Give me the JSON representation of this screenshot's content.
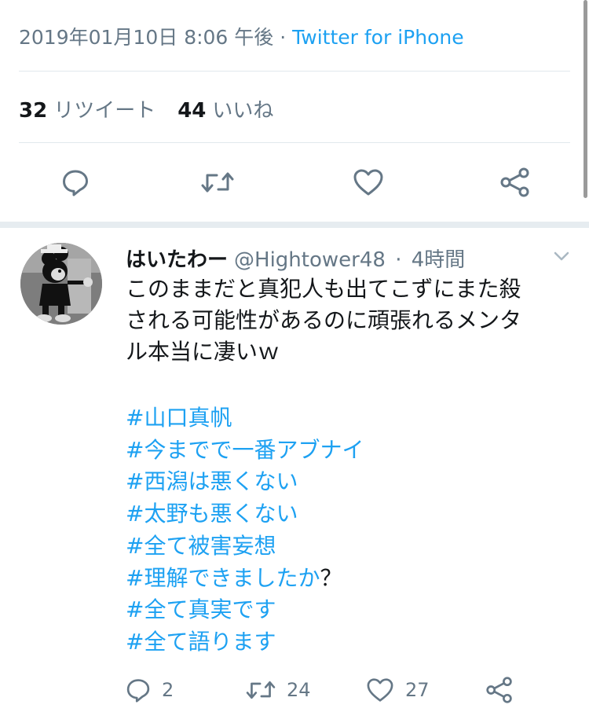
{
  "status": {
    "datetime": "2019年01月10日 8:06 午後",
    "separator": "·",
    "source": "Twitter for iPhone"
  },
  "stats": {
    "retweets_count": "32",
    "retweets_label": "リツイート",
    "likes_count": "44",
    "likes_label": "いいね"
  },
  "actions": {
    "reply_icon": "reply-icon",
    "retweet_icon": "retweet-icon",
    "like_icon": "heart-icon",
    "share_icon": "share-icon"
  },
  "reply": {
    "name": "はいたわー",
    "handle": "@Hightower48",
    "separator": "·",
    "time": "4時間",
    "text_lines": [
      "このままだと真犯人も出てこずにまた殺",
      "される可能性があるのに頑張れるメンタ",
      "ル本当に凄いｗ"
    ],
    "hashtags": [
      "#山口真帆",
      "#今までで一番アブナイ",
      "#西潟は悪くない",
      "#太野も悪くない",
      "#全て被害妄想",
      "#理解できましたか",
      "#全て真実です",
      "#全て語ります"
    ],
    "hashtag_suffix": "？",
    "reply_count": "2",
    "retweet_count": "24",
    "like_count": "27"
  },
  "colors": {
    "accent": "#1da1f2",
    "secondary_text": "#657786",
    "divider": "#e1e8ed",
    "section_separator": "#e6ecf0"
  }
}
